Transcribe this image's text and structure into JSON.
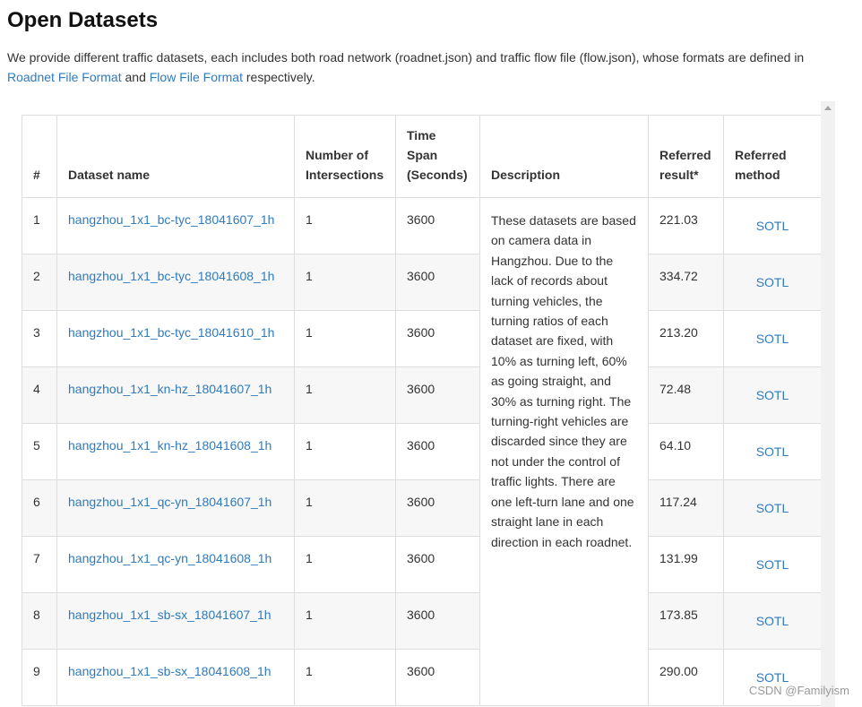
{
  "page_title": "Open Datasets",
  "intro": {
    "text_before": "We provide different traffic datasets, each includes both road network (roadnet.json) and traffic flow file (flow.json), whose formats are defined in ",
    "link_roadnet": "Roadnet File Format",
    "text_middle": " and ",
    "link_flow": "Flow File Format",
    "text_after": " respectively."
  },
  "table": {
    "headers": {
      "num": "#",
      "name": "Dataset name",
      "intersections": "Number of Intersections",
      "timespan": "Time Span (Seconds)",
      "description": "Description",
      "result": "Referred result*",
      "method": "Referred method"
    },
    "description": "These datasets are based on camera data in Hangzhou. Due to the lack of records about turning vehicles, the turning ratios of each dataset are fixed, with 10% as turning left, 60% as going straight, and 30% as turning right. The turning-right vehicles are discarded since they are not under the control of traffic lights. There are one left-turn lane and one straight lane in each direction in each roadnet.",
    "rows": [
      {
        "num": "1",
        "name": "hangzhou_1x1_bc-tyc_18041607_1h",
        "intersections": "1",
        "timespan": "3600",
        "result": "221.03",
        "method": "SOTL"
      },
      {
        "num": "2",
        "name": "hangzhou_1x1_bc-tyc_18041608_1h",
        "intersections": "1",
        "timespan": "3600",
        "result": "334.72",
        "method": "SOTL"
      },
      {
        "num": "3",
        "name": "hangzhou_1x1_bc-tyc_18041610_1h",
        "intersections": "1",
        "timespan": "3600",
        "result": "213.20",
        "method": "SOTL"
      },
      {
        "num": "4",
        "name": "hangzhou_1x1_kn-hz_18041607_1h",
        "intersections": "1",
        "timespan": "3600",
        "result": "72.48",
        "method": "SOTL"
      },
      {
        "num": "5",
        "name": "hangzhou_1x1_kn-hz_18041608_1h",
        "intersections": "1",
        "timespan": "3600",
        "result": "64.10",
        "method": "SOTL"
      },
      {
        "num": "6",
        "name": "hangzhou_1x1_qc-yn_18041607_1h",
        "intersections": "1",
        "timespan": "3600",
        "result": "117.24",
        "method": "SOTL"
      },
      {
        "num": "7",
        "name": "hangzhou_1x1_qc-yn_18041608_1h",
        "intersections": "1",
        "timespan": "3600",
        "result": "131.99",
        "method": "SOTL"
      },
      {
        "num": "8",
        "name": "hangzhou_1x1_sb-sx_18041607_1h",
        "intersections": "1",
        "timespan": "3600",
        "result": "173.85",
        "method": "SOTL"
      },
      {
        "num": "9",
        "name": "hangzhou_1x1_sb-sx_18041608_1h",
        "intersections": "1",
        "timespan": "3600",
        "result": "290.00",
        "method": "SOTL"
      }
    ]
  },
  "watermark": "CSDN @Familyism",
  "colors": {
    "link": "#2e7bbf",
    "border": "#dddddd",
    "stripe": "#f7f7f7"
  }
}
